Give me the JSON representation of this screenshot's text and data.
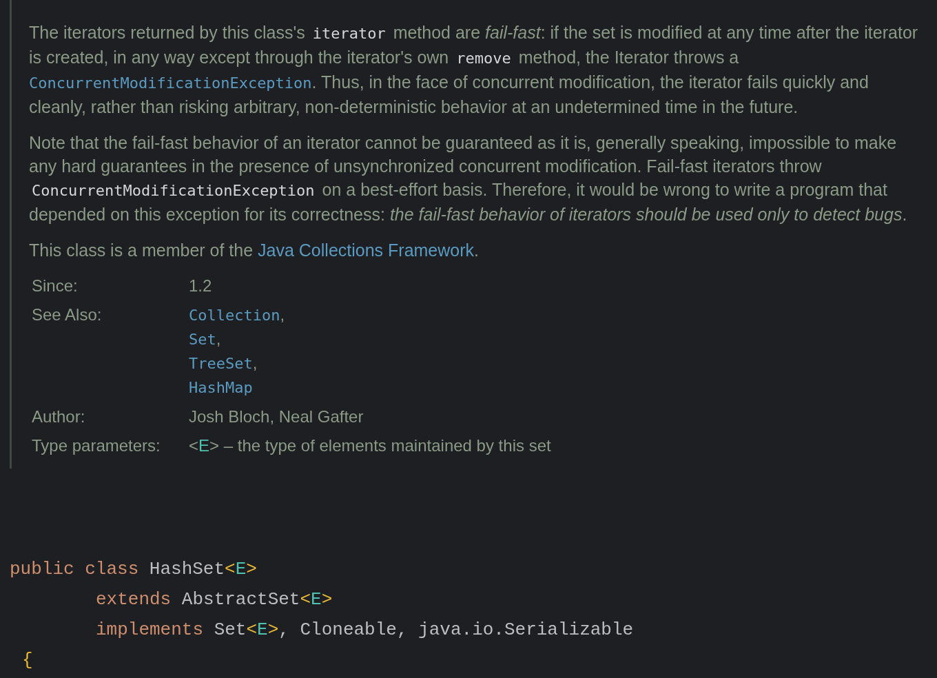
{
  "doc": {
    "paragraphs": [
      [
        {
          "kind": "text",
          "text": "The iterators returned by this class's "
        },
        {
          "kind": "code",
          "text": "iterator"
        },
        {
          "kind": "text",
          "text": " method are "
        },
        {
          "kind": "italic",
          "text": "fail-fast"
        },
        {
          "kind": "text",
          "text": ": if the set is modified at any time after the iterator is created, in any way except through the iterator's own "
        },
        {
          "kind": "code",
          "text": "remove"
        },
        {
          "kind": "text",
          "text": " method, the Iterator throws a "
        },
        {
          "kind": "codelink",
          "text": "ConcurrentModificationException"
        },
        {
          "kind": "text",
          "text": ". Thus, in the face of concurrent modification, the iterator fails quickly and cleanly, rather than risking arbitrary, non-deterministic behavior at an undetermined time in the future."
        }
      ],
      [
        {
          "kind": "text",
          "text": "Note that the fail-fast behavior of an iterator cannot be guaranteed as it is, generally speaking, impossible to make any hard guarantees in the presence of unsynchronized concurrent modification. Fail-fast iterators throw "
        },
        {
          "kind": "code",
          "text": "ConcurrentModificationException"
        },
        {
          "kind": "text",
          "text": " on a best-effort basis. Therefore, it would be wrong to write a program that depended on this exception for its correctness: "
        },
        {
          "kind": "italic",
          "text": "the fail-fast behavior of iterators should be used only to detect bugs"
        },
        {
          "kind": "text",
          "text": "."
        }
      ],
      [
        {
          "kind": "text",
          "text": "This class is a member of the "
        },
        {
          "kind": "link",
          "text": "Java Collections Framework"
        },
        {
          "kind": "text",
          "text": "."
        }
      ]
    ],
    "tags": [
      {
        "label": "Since:",
        "kind": "text",
        "value": [
          {
            "kind": "text",
            "text": "1.2"
          }
        ]
      },
      {
        "label": "See Also:",
        "kind": "links",
        "links": [
          {
            "text": "Collection",
            "sep": ","
          },
          {
            "text": "Set",
            "sep": ","
          },
          {
            "text": "TreeSet",
            "sep": ","
          },
          {
            "text": "HashMap"
          }
        ]
      },
      {
        "label": "Author:",
        "kind": "text",
        "value": [
          {
            "kind": "text",
            "text": "Josh Bloch, Neal Gafter"
          }
        ]
      },
      {
        "label": "Type parameters:",
        "kind": "text",
        "value": [
          {
            "kind": "text",
            "text": "<"
          },
          {
            "kind": "typevar",
            "text": "E"
          },
          {
            "kind": "text",
            "text": "> – the type of elements maintained by this set"
          }
        ]
      }
    ]
  },
  "code": [
    {
      "kind": "head",
      "tokens": [
        {
          "kind": "keyword",
          "text": "public "
        },
        {
          "kind": "keyword",
          "text": "class"
        },
        {
          "kind": "plain",
          "text": " HashSet"
        },
        {
          "kind": "bracket",
          "text": "<"
        },
        {
          "kind": "typevar",
          "text": "E"
        },
        {
          "kind": "bracket",
          "text": ">"
        }
      ]
    },
    {
      "kind": "continuation",
      "tokens": [
        {
          "kind": "keyword",
          "text": "extends"
        },
        {
          "kind": "plain",
          "text": " AbstractSet"
        },
        {
          "kind": "bracket",
          "text": "<"
        },
        {
          "kind": "typevar",
          "text": "E"
        },
        {
          "kind": "bracket",
          "text": ">"
        }
      ]
    },
    {
      "kind": "continuation",
      "tokens": [
        {
          "kind": "keyword",
          "text": "implements"
        },
        {
          "kind": "plain",
          "text": " Set"
        },
        {
          "kind": "bracket",
          "text": "<"
        },
        {
          "kind": "typevar",
          "text": "E"
        },
        {
          "kind": "bracket",
          "text": ">"
        },
        {
          "kind": "plain",
          "text": ", Cloneable, java.io.Serializable"
        }
      ]
    },
    {
      "kind": "brace",
      "tokens": [
        {
          "kind": "bracket",
          "text": "{"
        }
      ]
    }
  ]
}
